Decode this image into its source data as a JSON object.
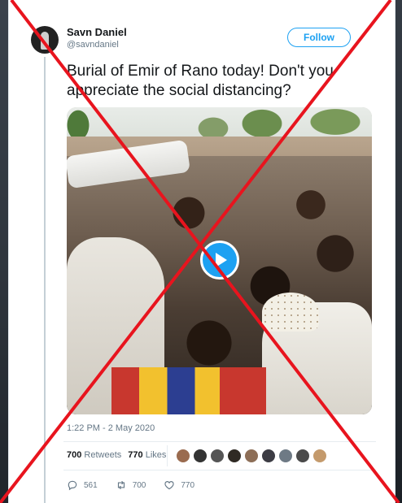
{
  "tweet": {
    "display_name": "Savn Daniel",
    "handle": "@savndaniel",
    "follow_label": "Follow",
    "text": "Burial of Emir of Rano today! Don't you appreciate the social distancing?",
    "timestamp": "1:22 PM - 2 May 2020"
  },
  "stats": {
    "retweets_count": "700",
    "retweets_label": "Retweets",
    "likes_count": "770",
    "likes_label": "Likes"
  },
  "actions": {
    "reply_count": "561",
    "retweet_count": "700",
    "like_count": "770"
  },
  "icons": [
    "play-icon",
    "reply-icon",
    "retweet-icon",
    "like-icon"
  ],
  "colors": {
    "accent": "#1da1f2",
    "cross": "#e8141e"
  }
}
